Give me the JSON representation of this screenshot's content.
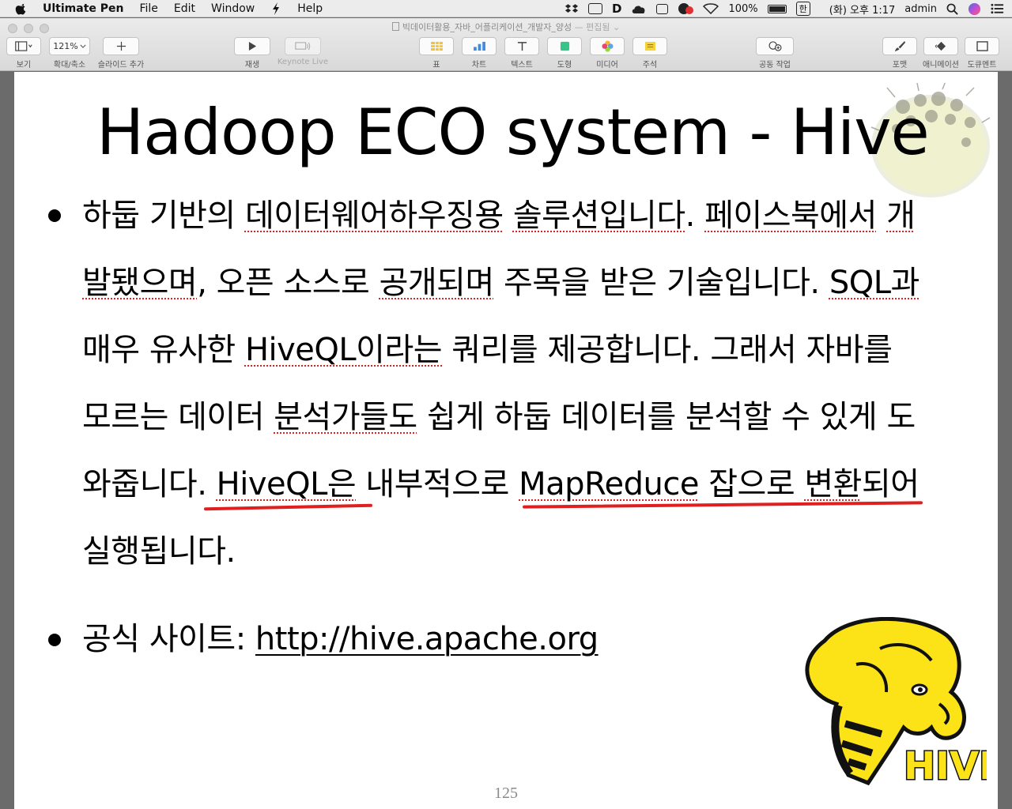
{
  "menubar": {
    "app_name": "Ultimate Pen",
    "menus": [
      "File",
      "Edit",
      "Window",
      "Help"
    ],
    "battery": "100%",
    "ime": "한",
    "clock": "(화) 오후 1:17",
    "user": "admin"
  },
  "window": {
    "document_title": "빅데이터활용_자바_어플리케이션_개발자_양성",
    "edited_suffix": "— 편집됨 ⌄"
  },
  "toolbar": {
    "zoom_value": "121%",
    "labels": {
      "view": "보기",
      "zoom": "확대/축소",
      "add_slide": "슬라이드 추가",
      "play": "재생",
      "keynote_live": "Keynote Live",
      "table": "표",
      "chart": "차트",
      "text": "텍스트",
      "shape": "도형",
      "media": "미디어",
      "comment": "주석",
      "collaborate": "공동 작업",
      "format": "포맷",
      "animate": "애니메이션",
      "document": "도큐멘트"
    }
  },
  "slide": {
    "title": "Hadoop ECO system - Hive",
    "bullet1": {
      "l1_a": "하둡 기반의 ",
      "l1_b": "데이터웨어하우징용",
      "l1_c": " ",
      "l1_d": "솔루션입니다",
      "l1_e": ". ",
      "l1_f": "페이스북에서",
      "l1_g": " ",
      "l1_h": "개",
      "l2_a": "발됐으며",
      "l2_b": ", 오픈 소스로 ",
      "l2_c": "공개되며",
      "l2_d": " 주목을 받은 기술입니다. ",
      "l2_e": "SQL과",
      "l3_a": "매우 유사한 ",
      "l3_b": "HiveQL이라는",
      "l3_c": " 쿼리를 제공합니다. 그래서 자바를",
      "l4_a": "모르는 데이터 ",
      "l4_b": "분석가들도",
      "l4_c": " 쉽게 하둡 데이터를 분석할 수 있게 도",
      "l5_a": "와줍니다. ",
      "l5_b": "HiveQL은",
      "l5_c": " 내부적으로 ",
      "l5_d": "MapReduce",
      "l5_e": " 잡으로 ",
      "l5_f": "변환",
      "l5_g": "되어",
      "l6": "실행됩니다."
    },
    "bullet2": {
      "label": "공식 사이트: ",
      "url": "http://hive.apache.org"
    },
    "logo_text": "HIVE",
    "page_number": "125"
  },
  "colors": {
    "pen_red": "#e01f1f",
    "hive_yellow": "#fbe318",
    "spellcheck_red": "#d22"
  }
}
